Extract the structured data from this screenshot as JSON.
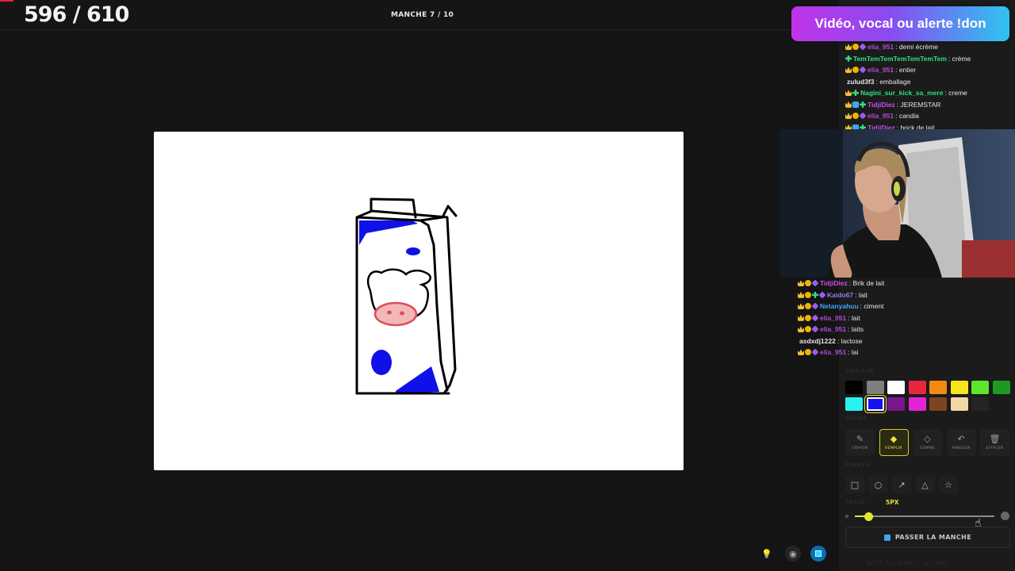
{
  "header": {
    "score": "596 / 610",
    "round": "MANCHE 7 / 10"
  },
  "donate_banner": "Vidéo, vocal ou alerte !don",
  "chat_top": [
    {
      "badges": [
        "crown",
        "coin",
        "gem"
      ],
      "user": "elia_951",
      "user_color": "#b14bd8",
      "message": "demi écrème"
    },
    {
      "badges": [
        "plus"
      ],
      "user": "TemTemTemTemTemTemTem",
      "user_color": "#2ee07a",
      "message": "crème"
    },
    {
      "badges": [
        "crown",
        "coin",
        "gem"
      ],
      "user": "elia_951",
      "user_color": "#b14bd8",
      "message": "entier"
    },
    {
      "badges": [],
      "user": "zulud3f3",
      "user_color": "#e6e6e6",
      "message": "emballage"
    },
    {
      "badges": [
        "crown",
        "plus"
      ],
      "user": "Nagini_sur_kick_sa_mere",
      "user_color": "#2ee07a",
      "message": "creme"
    },
    {
      "badges": [
        "crown",
        "mod",
        "plus"
      ],
      "user": "TidjiDiez",
      "user_color": "#c94ef0",
      "message": "JEREMSTAR"
    },
    {
      "badges": [
        "crown",
        "coin",
        "gem"
      ],
      "user": "elia_951",
      "user_color": "#b14bd8",
      "message": "candia"
    },
    {
      "badges": [
        "crown",
        "mod",
        "plus"
      ],
      "user": "TidjiDiez",
      "user_color": "#c94ef0",
      "message": "brick de lait"
    }
  ],
  "chat_bottom": [
    {
      "badges": [
        "crown",
        "coin",
        "gem"
      ],
      "user": "TidjiDiez",
      "user_color": "#c94ef0",
      "message": "Brik de lait"
    },
    {
      "badges": [
        "crown",
        "coin",
        "plus",
        "gem"
      ],
      "user": "Kaido67",
      "user_color": "#9a7cf0",
      "message": "lait"
    },
    {
      "badges": [
        "crown",
        "coin",
        "gem"
      ],
      "user": "Netanyahuu",
      "user_color": "#3ea7ff",
      "message": "ciment"
    },
    {
      "badges": [
        "crown",
        "coin",
        "gem"
      ],
      "user": "elia_951",
      "user_color": "#b14bd8",
      "message": "lait"
    },
    {
      "badges": [
        "crown",
        "coin",
        "gem"
      ],
      "user": "elia_951",
      "user_color": "#b14bd8",
      "message": "laits"
    },
    {
      "badges": [],
      "user": "asdxdj1222",
      "user_color": "#e6e6e6",
      "message": "lactose"
    },
    {
      "badges": [
        "crown",
        "coin",
        "gem"
      ],
      "user": "elia_951",
      "user_color": "#b14bd8",
      "message": "lai"
    }
  ],
  "chat_overlay": [
    {
      "user": "Netanyahuu",
      "user_color": "#3ea7ff",
      "message": "ciment"
    },
    {
      "user": "elia_951",
      "user_color": "#e0303a",
      "message": "lait"
    },
    {
      "user": "elia_951",
      "user_color": "#e0303a",
      "message": "laits"
    },
    {
      "user": "asdxdj1222",
      "user_color": "#e6e6e6",
      "message": "lactose"
    },
    {
      "user": "elia_951",
      "user_color": "#e0303a",
      "message": ""
    }
  ],
  "labels": {
    "couleur": "COULEUR",
    "outils": "OUTILS",
    "formes": "FORMES",
    "taille": "TAILLE",
    "size_value": "5PX"
  },
  "palette": [
    {
      "color": "#000000"
    },
    {
      "color": "#7f7f7f"
    },
    {
      "color": "#ffffff"
    },
    {
      "color": "#e8273e"
    },
    {
      "color": "#f28a10"
    },
    {
      "color": "#f6e51a"
    },
    {
      "color": "#5ce62b"
    },
    {
      "color": "#1e9a22"
    },
    {
      "color": "#28f1f1"
    },
    {
      "color": "#1414f0",
      "selected": true
    },
    {
      "color": "#7a1590"
    },
    {
      "color": "#e622d8"
    },
    {
      "color": "#7b4520"
    },
    {
      "color": "#f1d6a8"
    },
    {
      "color": "#252525"
    }
  ],
  "tools": [
    {
      "label": "CRAYON",
      "icon": "pencil-icon",
      "glyph": "✎"
    },
    {
      "label": "REMPLIR",
      "icon": "fill-bucket-icon",
      "glyph": "◆",
      "active": true
    },
    {
      "label": "GOMME",
      "icon": "eraser-icon",
      "glyph": "◇"
    },
    {
      "label": "ANNULER",
      "icon": "undo-icon",
      "glyph": "↶"
    },
    {
      "label": "EFFACER",
      "icon": "trash-icon",
      "glyph": "🗑"
    }
  ],
  "shapes": [
    {
      "icon": "rectangle-icon",
      "glyph": "□"
    },
    {
      "icon": "ellipse-icon",
      "glyph": "○"
    },
    {
      "icon": "arrow-icon",
      "glyph": "↗"
    },
    {
      "icon": "triangle-icon",
      "glyph": "△"
    },
    {
      "icon": "star-icon",
      "glyph": "☆"
    }
  ],
  "brush_size": {
    "value": 5,
    "fill_fraction": 0.1
  },
  "skip_button": "PASSER LA MANCHE",
  "footer_note": "built for mines · by taido",
  "stage_icons": [
    "lightbulb-icon",
    "eye-icon",
    "stop-icon"
  ]
}
